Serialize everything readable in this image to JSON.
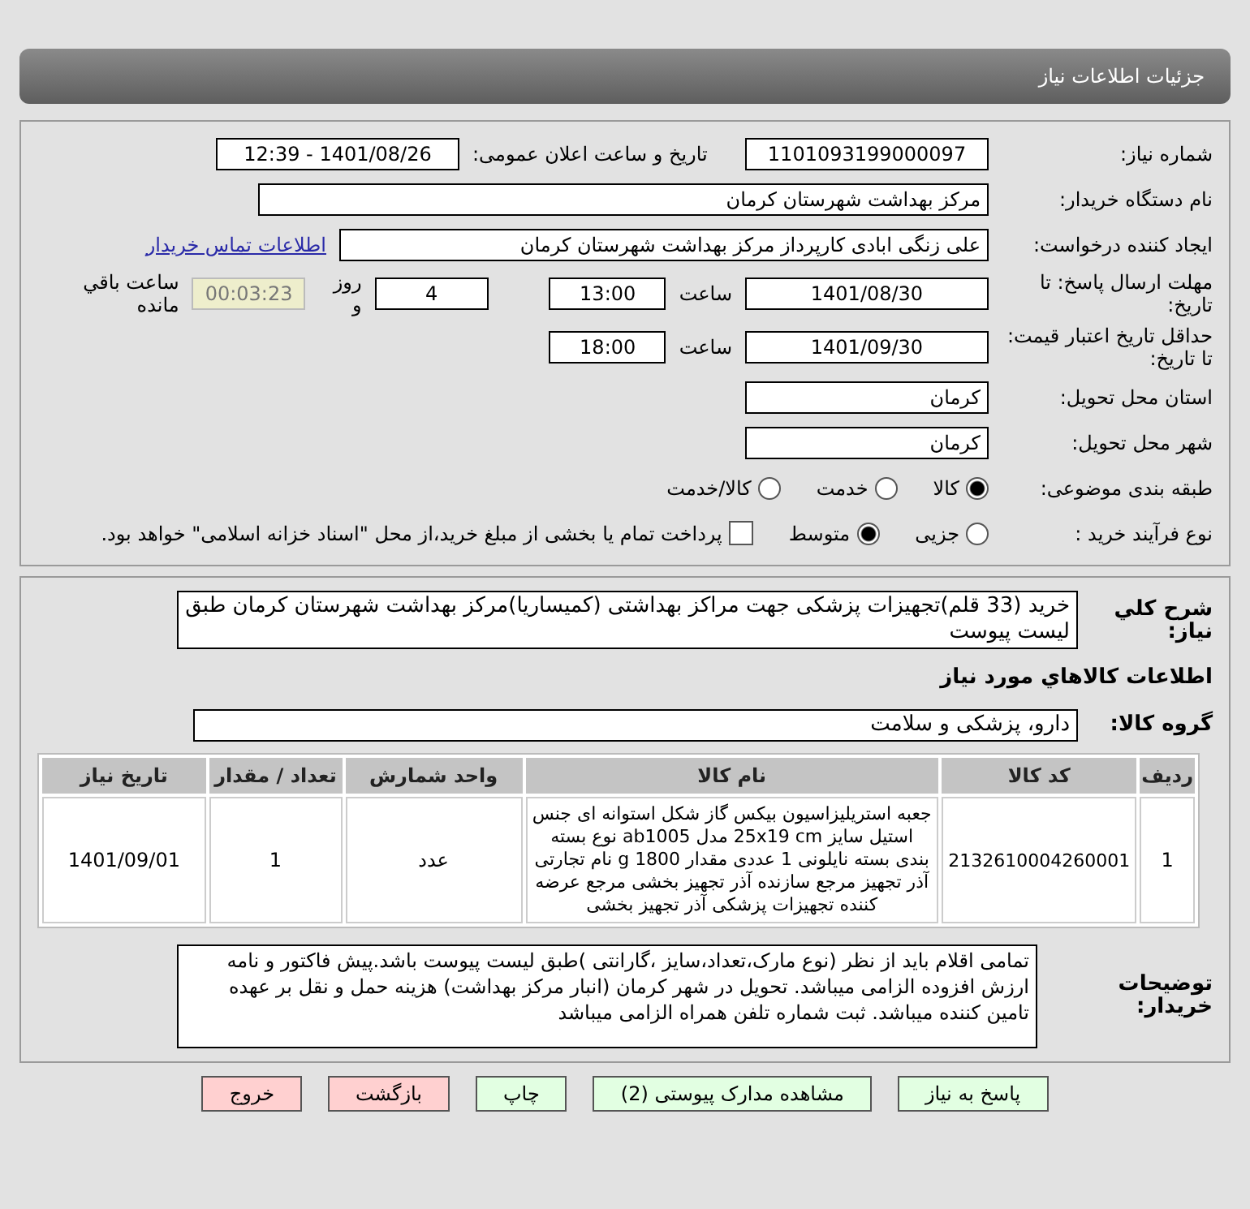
{
  "header": {
    "title": "جزئیات اطلاعات نیاز"
  },
  "need_number": {
    "label": "شماره نیاز:",
    "value": "1101093199000097"
  },
  "announce": {
    "label": "تاریخ و ساعت اعلان عمومی:",
    "value": "1401/08/26 - 12:39"
  },
  "buyer_org": {
    "label": "نام دستگاه خریدار:",
    "value": "مرکز بهداشت شهرستان کرمان"
  },
  "requester": {
    "label": "ایجاد کننده درخواست:",
    "value": "علی زنگی ابادی کارپرداز مرکز بهداشت شهرستان کرمان",
    "link": "اطلاعات تماس خریدار"
  },
  "deadlines": [
    {
      "label": "مهلت ارسال پاسخ: تا تاریخ:",
      "date": "1401/08/30",
      "time_label": "ساعت",
      "time": "13:00",
      "days": "4",
      "days_label": "روز و",
      "remaining": "00:03:23",
      "remaining_label": "ساعت باقي مانده"
    },
    {
      "label": "حداقل تاریخ اعتبار قیمت: تا تاریخ:",
      "date": "1401/09/30",
      "time_label": "ساعت",
      "time": "18:00"
    }
  ],
  "province": {
    "label": "استان محل تحویل:",
    "value": "کرمان"
  },
  "city": {
    "label": "شهر محل تحویل:",
    "value": "کرمان"
  },
  "category": {
    "label": "طبقه بندی موضوعی:",
    "options": [
      {
        "label": "کالا",
        "selected": true
      },
      {
        "label": "خدمت",
        "selected": false
      },
      {
        "label": "کالا/خدمت",
        "selected": false
      }
    ]
  },
  "purchase_type": {
    "label": "نوع فرآیند خرید :",
    "options": [
      {
        "label": "جزیی",
        "selected": false
      },
      {
        "label": "متوسط",
        "selected": true
      }
    ],
    "payment": {
      "checked": false,
      "label": "پرداخت تمام یا بخشی از مبلغ خرید،از محل \"اسناد خزانه اسلامی\" خواهد بود."
    }
  },
  "description": {
    "label": "شرح کلي نياز:",
    "value": "خرید (33 قلم)تجهیزات پزشکی جهت مراکز بهداشتی (کمیساریا)مرکز بهداشت شهرستان کرمان طبق لیست پیوست"
  },
  "goods_title": "اطلاعات کالاهاي مورد نياز",
  "goods_group": {
    "label": "گروه کالا:",
    "value": "دارو، پزشکی و سلامت"
  },
  "table": {
    "columns": [
      "ردیف",
      "کد کالا",
      "نام کالا",
      "واحد شمارش",
      "تعداد / مقدار",
      "تاریخ نیاز"
    ],
    "rows": [
      [
        "1",
        "2132610004260001",
        "جعبه استریلیزاسیون بیکس گاز شکل استوانه ای جنس استیل سایز 25x19 cm مدل ab1005 نوع بسته بندی بسته نایلونی 1 عددی مقدار 1800 g نام تجارتی آذر تجهیز مرجع سازنده آذر تجهیز بخشی مرجع عرضه کننده تجهیزات پزشکی آذر تجهیز بخشی",
        "عدد",
        "1",
        "1401/09/01"
      ]
    ]
  },
  "buyer_notes": {
    "label": "توضیحات خریدار:",
    "value": "تمامی اقلام باید از نظر (نوع مارک،تعداد،سایز ،گارانتی )طبق لیست پیوست باشد.پیش فاکتور و نامه ارزش افزوده الزامی میباشد. تحویل در شهر کرمان (انبار مرکز بهداشت) هزینه حمل و نقل بر عهده تامین کننده میباشد. ثبت شماره تلفن همراه الزامی میباشد"
  },
  "buttons": [
    {
      "label": "پاسخ به نیاز",
      "kind": "green"
    },
    {
      "label": "مشاهده مدارک پیوستی (2)",
      "kind": "green"
    },
    {
      "label": "چاپ",
      "kind": "green"
    },
    {
      "label": "بازگشت",
      "kind": "red"
    },
    {
      "label": "خروج",
      "kind": "red"
    }
  ]
}
